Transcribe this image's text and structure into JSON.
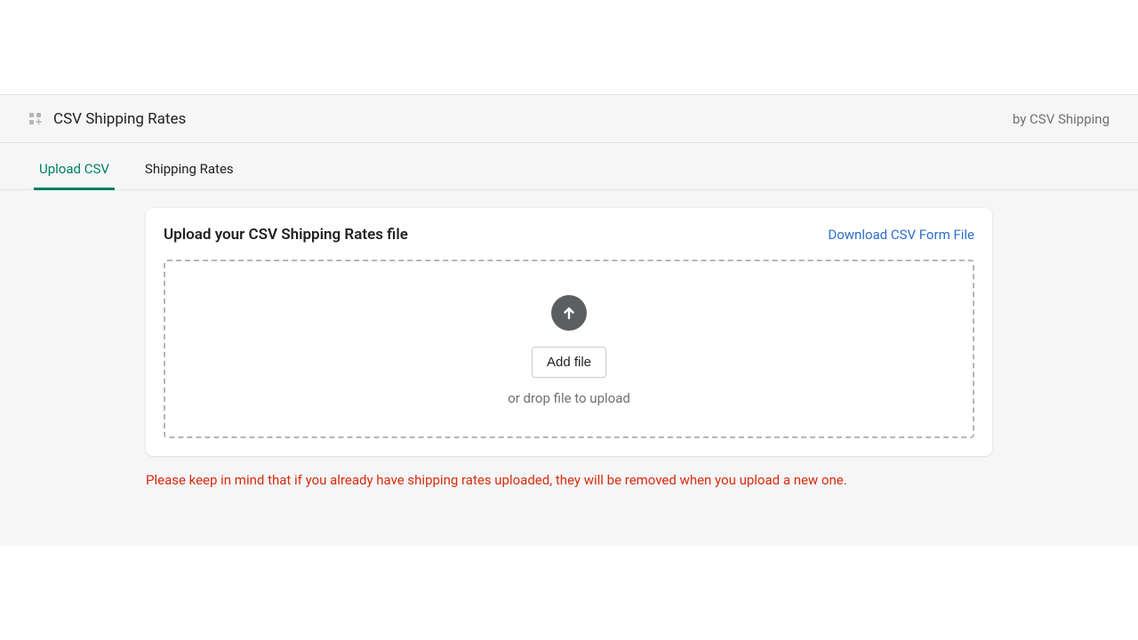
{
  "header": {
    "app_title": "CSV Shipping Rates",
    "byline": "by CSV Shipping"
  },
  "tabs": {
    "upload": "Upload CSV",
    "rates": "Shipping Rates"
  },
  "card": {
    "title": "Upload your CSV Shipping Rates file",
    "download_link": "Download CSV Form File",
    "add_file_label": "Add file",
    "drop_hint": "or drop file to upload"
  },
  "warning": "Please keep in mind that if you already have shipping rates uploaded, they will be removed when you upload a new one."
}
